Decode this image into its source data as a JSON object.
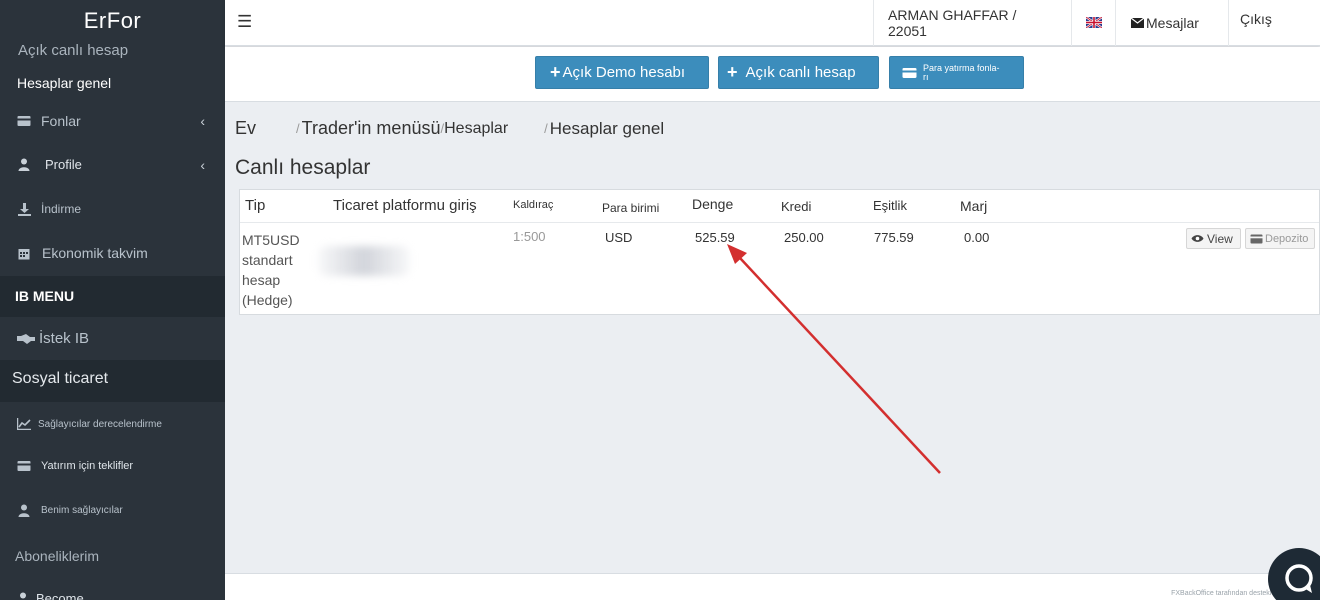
{
  "app": {
    "brand": "ErFor"
  },
  "sidebar": {
    "items": [
      {
        "label": "Açık canlı hesap"
      },
      {
        "label": "Hesaplar genel"
      },
      {
        "label": "Fonlar",
        "icon": "credit-card-icon"
      },
      {
        "label": "Profile",
        "icon": "user-icon"
      },
      {
        "label": "İndirme",
        "icon": "download-icon"
      },
      {
        "label": "Ekonomik takvim",
        "icon": "calendar-icon"
      }
    ],
    "ib_menu": "IB MENU",
    "istek_ib": "İstek IB",
    "sosyal": "Sosyal ticaret",
    "sosyal_items": [
      {
        "label": "Sağlayıcılar derecelendirme",
        "icon": "chart-icon"
      },
      {
        "label": "Yatırım için teklifler",
        "icon": "card-icon"
      },
      {
        "label": "Benim sağlayıcılar",
        "icon": "user-icon"
      }
    ],
    "abonelik": "Aboneliklerim",
    "become": "Become"
  },
  "topbar": {
    "user": "ARMAN GHAFFAR / 22051",
    "messages": "Mesajlar",
    "logout": "Çıkış"
  },
  "actions": {
    "demo": "Açık Demo hesabı",
    "live": "Açık canlı hesap",
    "fund_line1": "Para yatırma fonla-",
    "fund_line2": "rı"
  },
  "breadcrumb": [
    "Ev",
    "Trader'in menüsü",
    "Hesaplar",
    "Hesaplar genel"
  ],
  "page_title": "Canlı hesaplar",
  "table": {
    "headers": {
      "tip": "Tip",
      "platform": "Ticaret platformu giriş",
      "leverage": "Kaldıraç",
      "currency": "Para birimi",
      "balance": "Denge",
      "credit": "Kredi",
      "equity": "Eşitlik",
      "margin": "Marj"
    },
    "row": {
      "tip_lines": [
        "MT5USD",
        "standart",
        "hesap",
        "(Hedge)"
      ],
      "leverage": "1:500",
      "currency": "USD",
      "balance": "525.59",
      "credit": "250.00",
      "equity": "775.59",
      "margin": "0.00",
      "view": "View",
      "deposit": "Depozito"
    }
  },
  "footer": {
    "note": "FXBackOffice tarafından desteklenmektedir"
  },
  "colors": {
    "accent": "#3c8dbc",
    "sidebar": "#2b333b",
    "arrow": "#d32f2f"
  }
}
